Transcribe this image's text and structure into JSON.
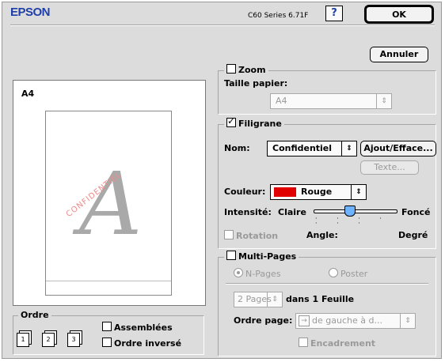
{
  "header": {
    "brand": "EPSON",
    "driver_version": "C60 Series 6.71F",
    "help_label": "?"
  },
  "buttons": {
    "ok": "OK",
    "cancel": "Annuler"
  },
  "preview": {
    "paper_label": "A4",
    "watermark_letter": "A",
    "watermark_text": "CONFIDENTIEL"
  },
  "order": {
    "title": "Ordre",
    "page_icons": [
      "1",
      "2",
      "3"
    ],
    "collated_label": "Assemblées",
    "reverse_label": "Ordre inversé"
  },
  "zoom": {
    "label": "Zoom",
    "checked": false,
    "paper_size_label": "Taille papier:",
    "paper_size_value": "A4"
  },
  "watermark": {
    "label": "Filigrane",
    "checked": true,
    "name_label": "Nom:",
    "name_value": "Confidentiel",
    "add_remove_label": "Ajout/Efface...",
    "text_label": "Texte...",
    "color_label": "Couleur:",
    "color_value": "Rouge",
    "color_swatch": "#e00000",
    "intensity_label": "Intensité:",
    "intensity_light": "Claire",
    "intensity_dark": "Foncé",
    "intensity_level": 0.42,
    "rotation_label": "Rotation",
    "angle_label": "Angle:",
    "degree_label": "Degré"
  },
  "multipages": {
    "label": "Multi-Pages",
    "checked": false,
    "npages_label": "N-Pages",
    "poster_label": "Poster",
    "pages_value": "2 Pages",
    "per_sheet_label": "dans 1 Feuille",
    "page_order_label": "Ordre page:",
    "page_order_value": "de gauche à d...",
    "border_label": "Encadrement"
  }
}
